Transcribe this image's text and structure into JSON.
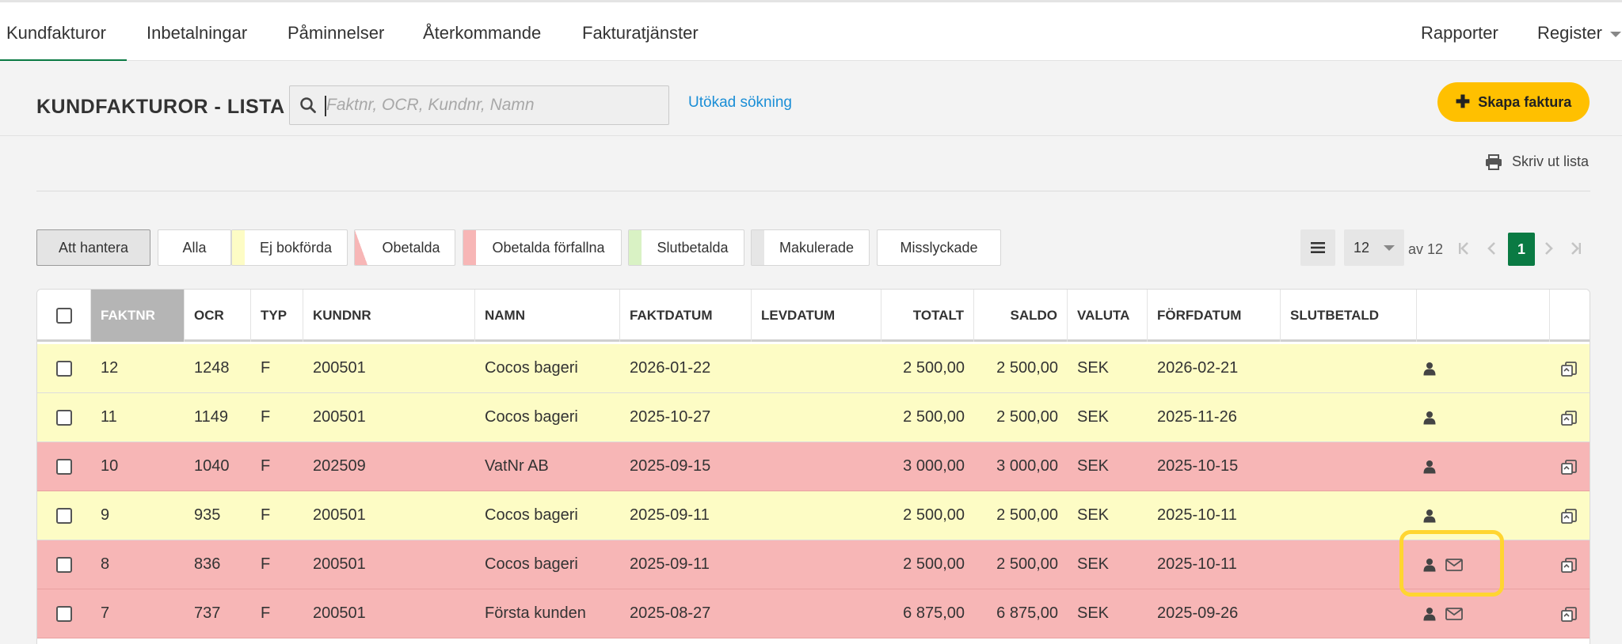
{
  "nav": {
    "tabs": [
      "Kundfakturor",
      "Inbetalningar",
      "Påminnelser",
      "Återkommande",
      "Fakturatjänster"
    ],
    "right_tabs": [
      "Rapporter",
      "Register"
    ],
    "active_tab": "Kundfakturor",
    "accent_color": "#0a7a43"
  },
  "header": {
    "title": "KUNDFAKTUROR - LISTA",
    "search_placeholder": "Faktnr, OCR, Kundnr, Namn",
    "search_value": "",
    "advanced_search": "Utökad sökning",
    "create_button": "Skapa faktura",
    "create_button_color": "#ffc000"
  },
  "toolbar": {
    "print_label": "Skriv ut lista"
  },
  "filters": [
    {
      "label": "Att hantera",
      "selected": true,
      "swatch": null
    },
    {
      "label": "Alla",
      "selected": false,
      "swatch": null
    },
    {
      "label": "Ej bokförda",
      "selected": false,
      "swatch": "#fdfcc5"
    },
    {
      "label": "Obetalda",
      "selected": false,
      "swatch": "half-red"
    },
    {
      "label": "Obetalda förfallna",
      "selected": false,
      "swatch": "#f7b6b6"
    },
    {
      "label": "Slutbetalda",
      "selected": false,
      "swatch": "#d9f2c4"
    },
    {
      "label": "Makulerade",
      "selected": false,
      "swatch": "#e6e6e6"
    },
    {
      "label": "Misslyckade",
      "selected": false,
      "swatch": null
    }
  ],
  "pagination": {
    "page_size": "12",
    "of_label": "av 12",
    "current_page": "1"
  },
  "table": {
    "columns": [
      "FAKTNR",
      "OCR",
      "TYP",
      "KUNDNR",
      "NAMN",
      "FAKTDATUM",
      "LEVDATUM",
      "TOTALT",
      "SALDO",
      "VALUTA",
      "FÖRFDATUM",
      "SLUTBETALD"
    ],
    "sorted_column": "FAKTNR",
    "rows": [
      {
        "faktnr": "12",
        "ocr": "1248",
        "typ": "F",
        "kundnr": "200501",
        "namn": "Cocos bageri",
        "faktdatum": "2026-01-22",
        "levdatum": "",
        "totalt": "2 500,00",
        "saldo": "2 500,00",
        "valuta": "SEK",
        "forfdatum": "2026-02-21",
        "slutbetald": "",
        "status": "yellow",
        "has_email": false
      },
      {
        "faktnr": "11",
        "ocr": "1149",
        "typ": "F",
        "kundnr": "200501",
        "namn": "Cocos bageri",
        "faktdatum": "2025-10-27",
        "levdatum": "",
        "totalt": "2 500,00",
        "saldo": "2 500,00",
        "valuta": "SEK",
        "forfdatum": "2025-11-26",
        "slutbetald": "",
        "status": "yellow",
        "has_email": false
      },
      {
        "faktnr": "10",
        "ocr": "1040",
        "typ": "F",
        "kundnr": "202509",
        "namn": "VatNr AB",
        "faktdatum": "2025-09-15",
        "levdatum": "",
        "totalt": "3 000,00",
        "saldo": "3 000,00",
        "valuta": "SEK",
        "forfdatum": "2025-10-15",
        "slutbetald": "",
        "status": "red",
        "has_email": false
      },
      {
        "faktnr": "9",
        "ocr": "935",
        "typ": "F",
        "kundnr": "200501",
        "namn": "Cocos bageri",
        "faktdatum": "2025-09-11",
        "levdatum": "",
        "totalt": "2 500,00",
        "saldo": "2 500,00",
        "valuta": "SEK",
        "forfdatum": "2025-10-11",
        "slutbetald": "",
        "status": "yellow",
        "has_email": false
      },
      {
        "faktnr": "8",
        "ocr": "836",
        "typ": "F",
        "kundnr": "200501",
        "namn": "Cocos bageri",
        "faktdatum": "2025-09-11",
        "levdatum": "",
        "totalt": "2 500,00",
        "saldo": "2 500,00",
        "valuta": "SEK",
        "forfdatum": "2025-10-11",
        "slutbetald": "",
        "status": "red",
        "has_email": true
      },
      {
        "faktnr": "7",
        "ocr": "737",
        "typ": "F",
        "kundnr": "200501",
        "namn": "Första kunden",
        "faktdatum": "2025-08-27",
        "levdatum": "",
        "totalt": "6 875,00",
        "saldo": "6 875,00",
        "valuta": "SEK",
        "forfdatum": "2025-09-26",
        "slutbetald": "",
        "status": "red",
        "has_email": true
      }
    ]
  },
  "icons": {
    "search": "search-icon",
    "print": "printer-icon",
    "menu": "list-menu-icon",
    "customer": "person-icon",
    "email": "envelope-icon",
    "copy": "copy-icon"
  }
}
